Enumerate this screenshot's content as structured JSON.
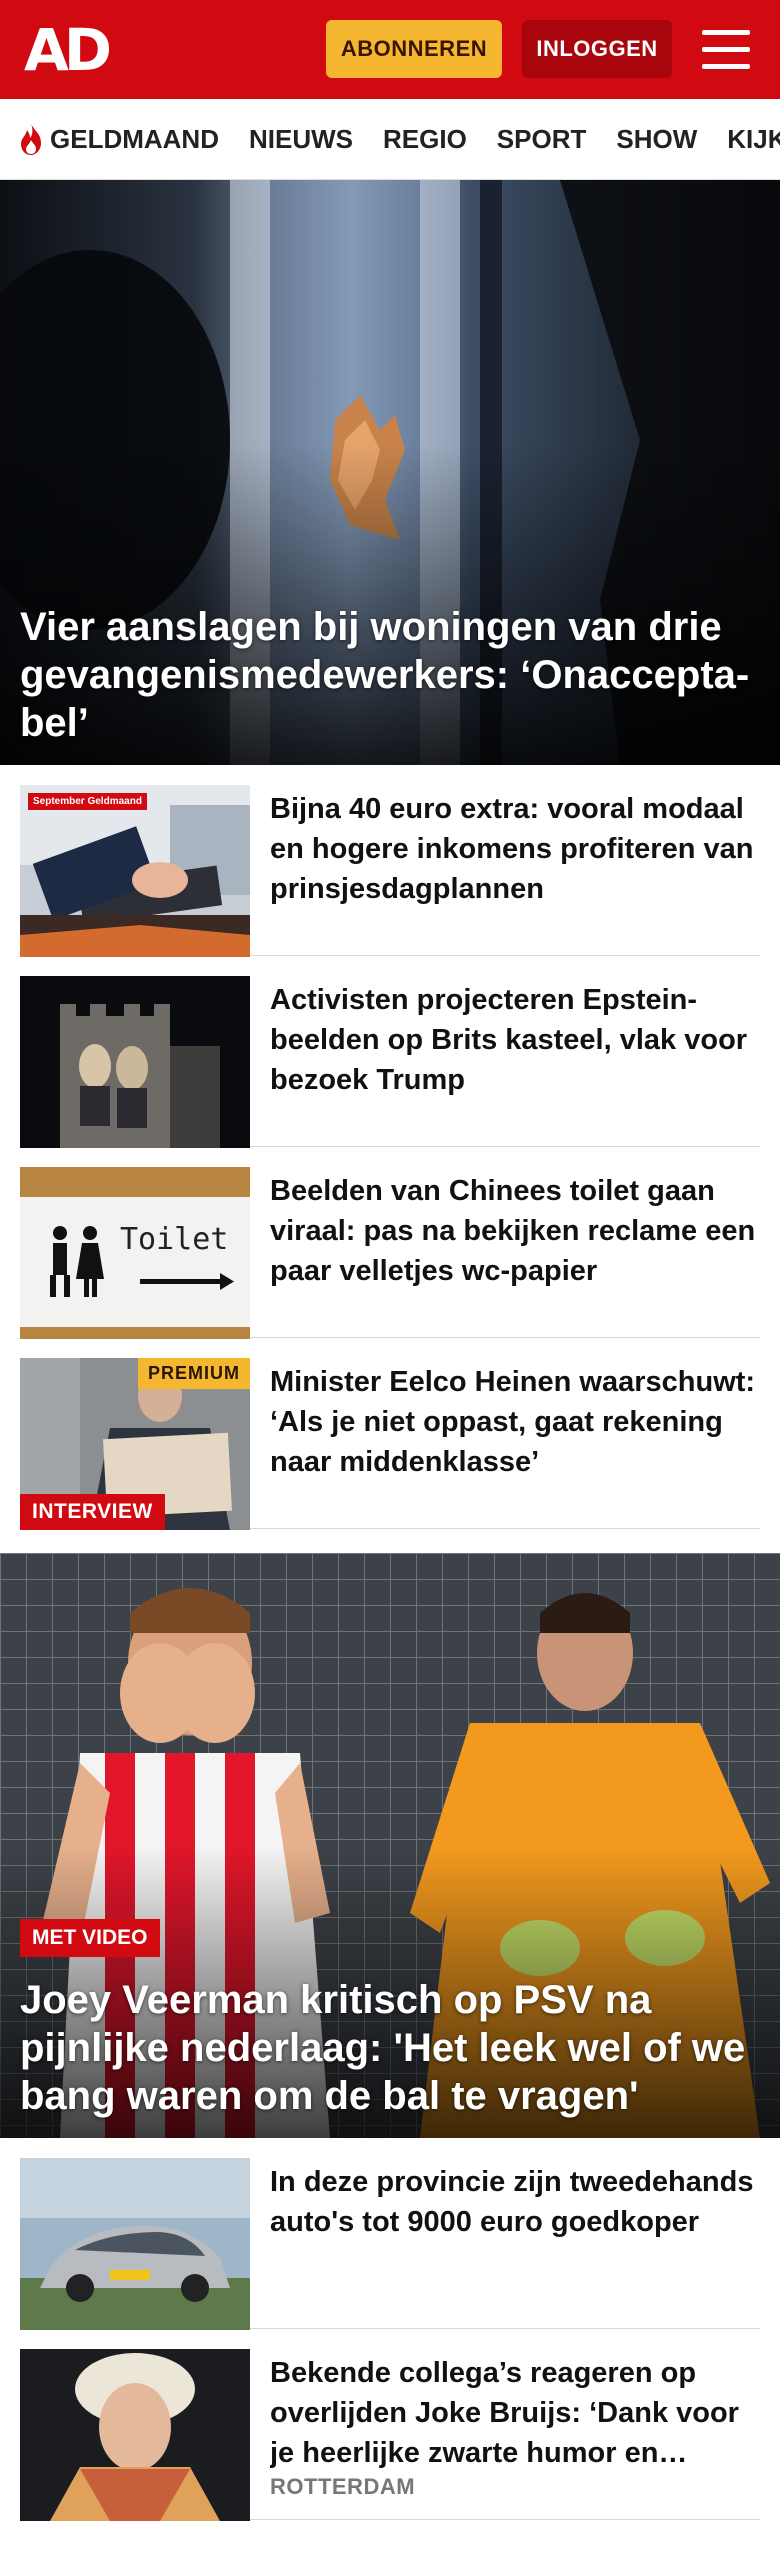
{
  "header": {
    "logo": "AD",
    "subscribe_label": "ABONNEREN",
    "login_label": "INLOGGEN",
    "brand_color": "#d10a11",
    "accent_color": "#f6b730"
  },
  "nav": {
    "items": [
      {
        "label": "GELDMAAND",
        "icon": "flame-icon"
      },
      {
        "label": "NIEUWS"
      },
      {
        "label": "REGIO"
      },
      {
        "label": "SPORT"
      },
      {
        "label": "SHOW"
      },
      {
        "label": "KIJK"
      }
    ]
  },
  "hero1": {
    "title": "Vier aanslagen bij woningen van drie gevangenismedewerkers: ‘Onaccepta­bel’"
  },
  "articles1": [
    {
      "title": "Bijna 40 euro extra: vooral modaal en hogere inkomens profiteren van prinsjesdagplannen",
      "thumb_logo": "September Geldmaand"
    },
    {
      "title": "Activisten projecteren Epstein­beelden op Brits kasteel, vlak voor bezoek Trump"
    },
    {
      "title": "Beelden van Chinees toilet gaan viraal: pas na bekijken reclame een paar velletjes wc-papier",
      "thumb_sign": "Toilet"
    },
    {
      "title": "Minister Eelco Heinen waarschuwt: ‘Als je niet oppast, gaat rekening naar middenklasse’",
      "premium": "PREMIUM",
      "label": "INTERVIEW"
    }
  ],
  "hero2": {
    "badge": "MET VIDEO",
    "title": "Joey Veerman kritisch op PSV na pijnlijke nederlaag: 'Het leek wel of we bang waren om de bal te vragen'"
  },
  "articles2": [
    {
      "title": "In deze provincie zijn tweede­hands auto's tot 9000 euro goedkoper"
    },
    {
      "title": "Bekende collega’s reageren op overlijden Joke Bruijs: ‘Dank voor je heerlijke zwarte humor en…",
      "meta": "ROTTERDAM"
    }
  ]
}
